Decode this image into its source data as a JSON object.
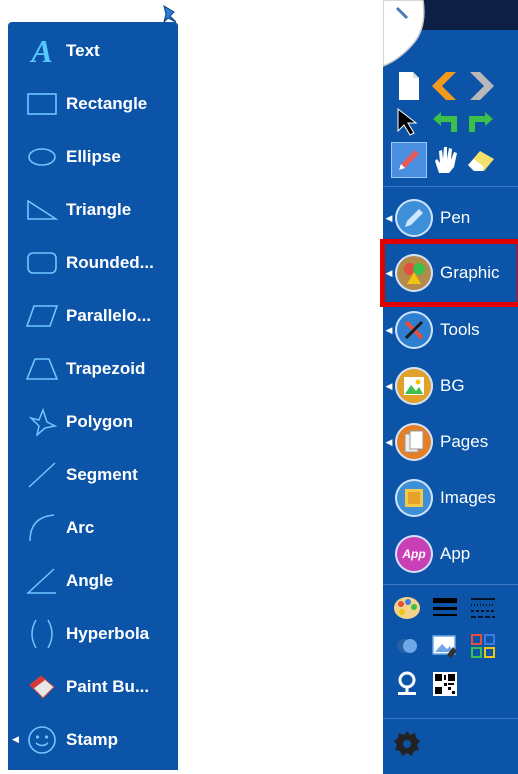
{
  "shapes_panel": {
    "items": [
      {
        "label": "Text",
        "icon": "text-icon"
      },
      {
        "label": "Rectangle",
        "icon": "rectangle-icon"
      },
      {
        "label": "Ellipse",
        "icon": "ellipse-icon"
      },
      {
        "label": "Triangle",
        "icon": "triangle-icon"
      },
      {
        "label": "Rounded...",
        "icon": "rounded-rectangle-icon"
      },
      {
        "label": "Parallelo...",
        "icon": "parallelogram-icon"
      },
      {
        "label": "Trapezoid",
        "icon": "trapezoid-icon"
      },
      {
        "label": "Polygon",
        "icon": "polygon-icon"
      },
      {
        "label": "Segment",
        "icon": "segment-icon"
      },
      {
        "label": "Arc",
        "icon": "arc-icon"
      },
      {
        "label": "Angle",
        "icon": "angle-icon"
      },
      {
        "label": "Hyperbola",
        "icon": "hyperbola-icon"
      },
      {
        "label": "Paint Bu...",
        "icon": "paint-bucket-icon"
      },
      {
        "label": "Stamp",
        "icon": "stamp-icon"
      }
    ]
  },
  "toolbar": {
    "menu": [
      {
        "label": "Pen",
        "icon": "pen-icon"
      },
      {
        "label": "Graphic",
        "icon": "graphics-icon"
      },
      {
        "label": "Tools",
        "icon": "tools-icon"
      },
      {
        "label": "BG",
        "icon": "background-icon"
      },
      {
        "label": "Pages",
        "icon": "pages-icon"
      },
      {
        "label": "Images",
        "icon": "images-icon"
      },
      {
        "label": "App",
        "icon": "app-icon"
      }
    ],
    "app_badge": "App"
  },
  "colors": {
    "panel_blue": "#0b54a8",
    "highlight_red": "#e00000",
    "accent_cyan": "#55c8ff"
  }
}
